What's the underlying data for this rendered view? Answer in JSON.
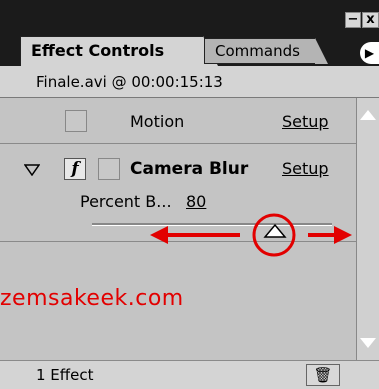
{
  "window": {
    "minimize_label": "−",
    "close_label": "x"
  },
  "tabs": [
    {
      "label": "Effect Controls",
      "active": true
    },
    {
      "label": "Commands",
      "active": false
    }
  ],
  "panel_menu_icon": "menu-arrow-icon",
  "clip": {
    "label": "Finale.avi @ 00:00:15:13"
  },
  "effects": [
    {
      "name": "Motion",
      "setup_label": "Setup"
    },
    {
      "name": "Camera Blur",
      "setup_label": "Setup",
      "parameter": {
        "label": "Percent B...",
        "value": "80"
      }
    }
  ],
  "watermark": "zemsakeek.com",
  "status": {
    "text": "1 Effect",
    "trash_icon": "trash-icon"
  },
  "colors": {
    "annotation": "#e20000",
    "titlebar": "#1b1b1b",
    "panel": "#c4c4c4"
  }
}
